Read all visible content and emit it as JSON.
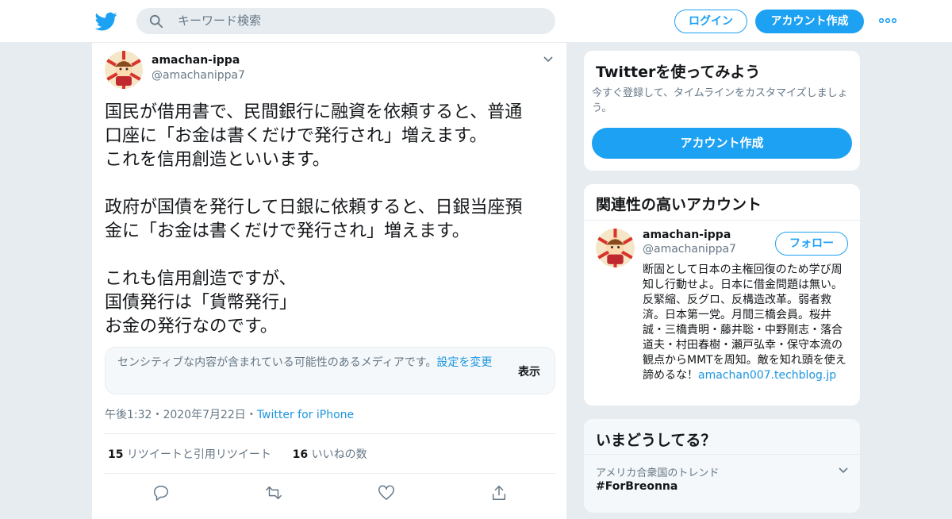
{
  "header": {
    "logo": "twitter-bird-icon",
    "search_placeholder": "キーワード検索",
    "login_label": "ログイン",
    "signup_label": "アカウント作成",
    "more_icon": "more-dots-icon",
    "brand_color": "#1da1f2"
  },
  "tweet": {
    "author_name": "amachan-ippa",
    "author_handle": "@amachanippa7",
    "body": "国民が借用書で、民間銀行に融資を依頼すると、普通\n口座に「お金は書くだけで発行され」増えます。\nこれを信用創造といいます。\n\n政府が国債を発行して日銀に依頼すると、日銀当座預\n金に「お金は書くだけで発行され」増えます。\n\nこれも信用創造ですが、\n国債発行は「貨幣発行」\nお金の発行なのです。",
    "sensitive_text": "センシティブな内容が含まれている可能性のあるメディアです。",
    "sensitive_link": "設定を変更",
    "sensitive_show": "表示",
    "time": "午後1:32",
    "date": "2020年7月22日",
    "source": "Twitter for iPhone",
    "retweet_count": "15",
    "retweet_label": "リツイートと引用リツイート",
    "like_count": "16",
    "like_label": "いいねの数"
  },
  "signup_panel": {
    "title": "Twitterを使ってみよう",
    "description": "今すぐ登録して、タイムラインをカスタマイズしましょう。",
    "button": "アカウント作成"
  },
  "related_panel": {
    "title": "関連性の高いアカウント",
    "name": "amachan-ippa",
    "handle": "@amachanippa7",
    "follow": "フォロー",
    "bio": "断固として日本の主権回復のため学び周知し行動せよ。日本に借金問題は無い。反緊縮、反グロ、反構造改革。弱者救済。日本第一党。月間三橋会員。桜井誠・三橋貴明・藤井聡・中野剛志・落合道夫・村田春樹・瀬戸弘幸・保守本流の観点からMMTを周知。敵を知れ頭を使え諦めるな！",
    "bio_link": "amachan007.techblog.jp"
  },
  "trends_panel": {
    "title": "いまどうしてる？",
    "location": "アメリカ合衆国のトレンド",
    "tag": "#ForBreonna"
  }
}
